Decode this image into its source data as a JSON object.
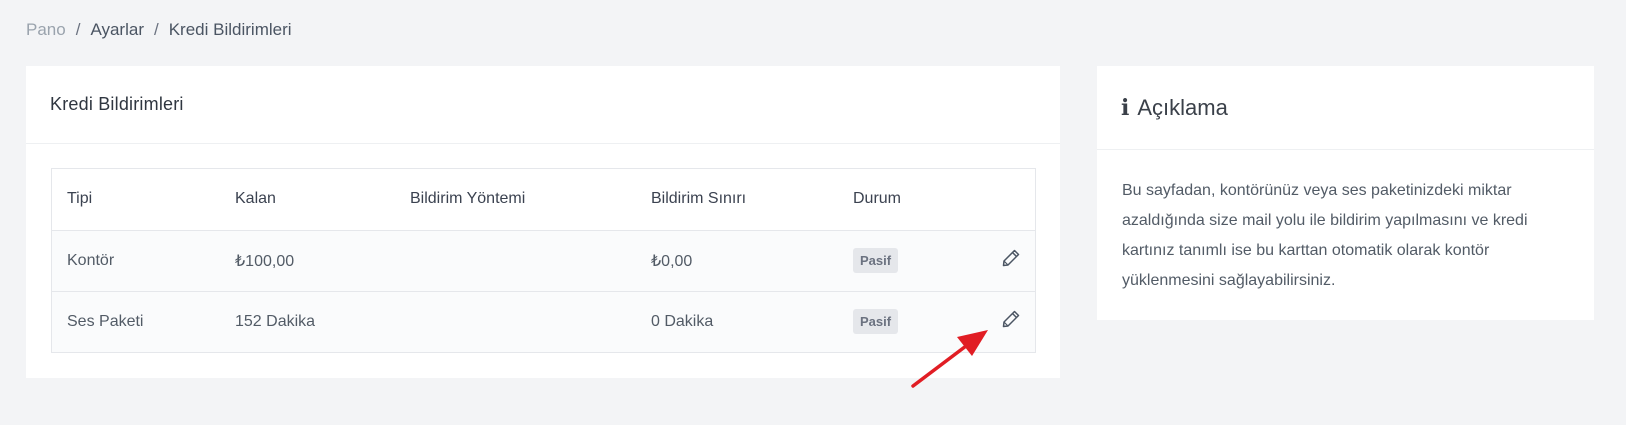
{
  "breadcrumb": {
    "items": [
      "Pano",
      "Ayarlar",
      "Kredi Bildirimleri"
    ],
    "separator": "/"
  },
  "main_card": {
    "title": "Kredi Bildirimleri",
    "table": {
      "headers": [
        "Tipi",
        "Kalan",
        "Bildirim Yöntemi",
        "Bildirim Sınırı",
        "Durum"
      ],
      "rows": [
        {
          "tipi": "Kontör",
          "kalan": "₺100,00",
          "yontem": "",
          "sinir": "₺0,00",
          "durum": "Pasif"
        },
        {
          "tipi": "Ses Paketi",
          "kalan": "152 Dakika",
          "yontem": "",
          "sinir": "0 Dakika",
          "durum": "Pasif"
        }
      ]
    }
  },
  "side_card": {
    "title": "Açıklama",
    "icon": "info-icon",
    "body": "Bu sayfadan, kontörünüz veya ses paketinizdeki miktar azaldığında size mail yolu ile bildirim yapılmasını ve kredi kartınız tanımlı ise bu karttan otomatik olarak kontör yüklenmesini sağlayabilirsiniz."
  },
  "colors": {
    "background": "#f3f4f6",
    "card": "#ffffff",
    "badge_bg": "#e5e7eb",
    "annotation_arrow": "#e11d24"
  },
  "icons": {
    "edit": "pencil-icon",
    "annotation": "red-arrow-annotation"
  }
}
